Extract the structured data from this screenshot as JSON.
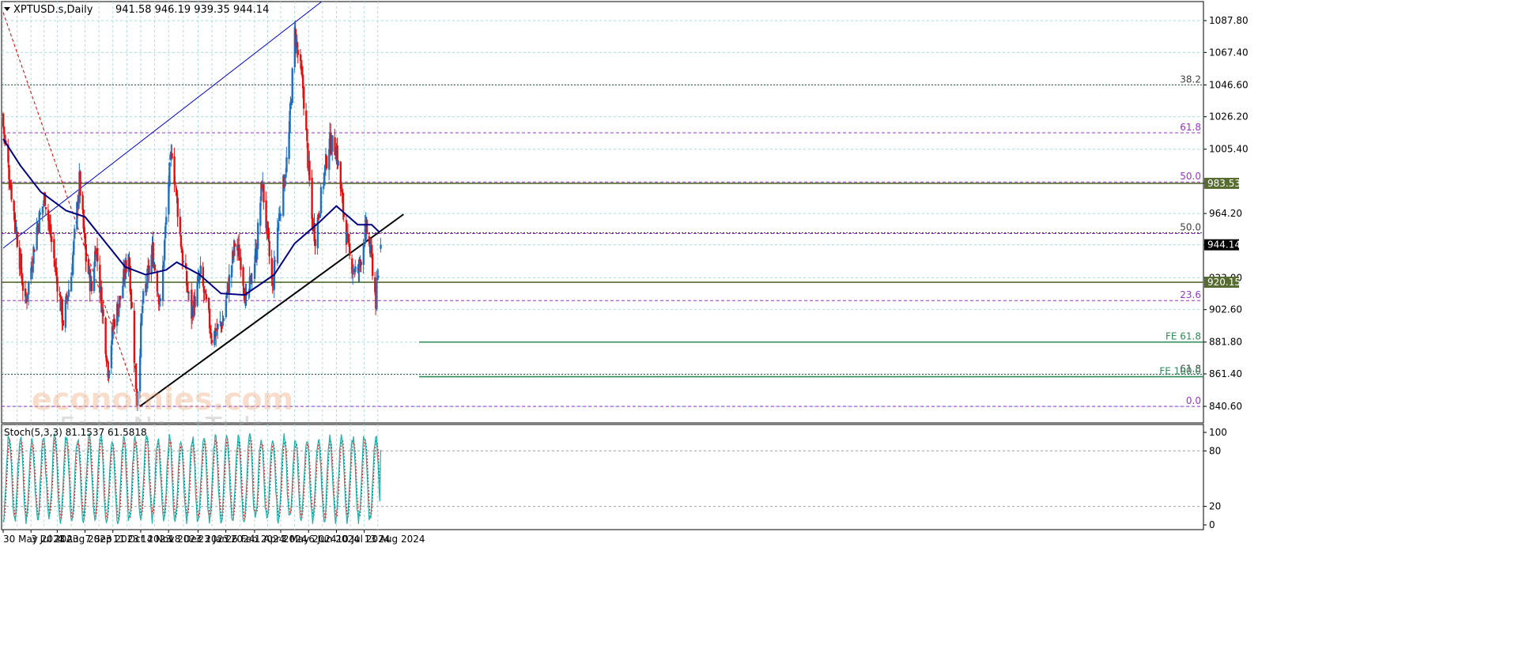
{
  "header": {
    "symbol": "XPTUSD.s,Daily",
    "ohlc": "941.58 946.19 939.35 944.14",
    "menu_icon": "triangle-down-icon"
  },
  "watermark": {
    "line1": "economies.com",
    "line2": "ForexNewsToday"
  },
  "chart_data": [
    {
      "type": "candlestick",
      "symbol": "XPTUSD.s",
      "timeframe": "Daily",
      "last": {
        "open": 941.58,
        "high": 946.19,
        "low": 939.35,
        "close": 944.14
      },
      "ylim": [
        830,
        1100
      ],
      "price_ticks": [
        840.6,
        861.4,
        881.8,
        902.6,
        923.0,
        944.14,
        964.2,
        983.53,
        1005.4,
        1026.2,
        1046.6,
        1067.4,
        1087.8
      ],
      "price_tick_labels": [
        "840.60",
        "861.40",
        "881.80",
        "902.60",
        "923.00",
        "944.14",
        "964.20",
        "983.53",
        "1005.40",
        "1026.20",
        "1046.60",
        "1067.40",
        "1087.80"
      ],
      "highlighted_prices": [
        {
          "label": "983.53",
          "value": 983.53,
          "bg": "#556b2f"
        },
        {
          "label": "944.14",
          "value": 944.14,
          "bg": "#000000"
        },
        {
          "label": "920.15",
          "value": 920.15,
          "bg": "#556b2f"
        }
      ],
      "x_tick_labels": [
        "30 May 2023",
        "3 Jul 2023",
        "4 Aug 2023",
        "7 Sep 2023",
        "11 Oct 2023",
        "14 Nov 2023",
        "18 Dec 2023",
        "23 Jan 2024",
        "26 Feb 2024",
        "1 Apr 2024",
        "3 May 2024",
        "6 Jun 2024",
        "10 Jul 2024",
        "13 Aug 2024"
      ],
      "keypoints": [
        {
          "date": "30 May 2023",
          "close": 1020
        },
        {
          "date": "2023-06-12",
          "close": 965
        },
        {
          "date": "2023-06-26",
          "close": 905
        },
        {
          "date": "2023-07-10",
          "close": 955
        },
        {
          "date": "2023-07-20",
          "close": 975
        },
        {
          "date": "2023-07-31",
          "close": 935
        },
        {
          "date": "2023-08-11",
          "close": 895
        },
        {
          "date": "2023-08-21",
          "close": 925
        },
        {
          "date": "2023-08-31",
          "close": 985
        },
        {
          "date": "2023-09-08",
          "close": 935
        },
        {
          "date": "2023-09-15",
          "close": 915
        },
        {
          "date": "2023-09-20",
          "close": 945
        },
        {
          "date": "2023-10-05",
          "close": 865
        },
        {
          "date": "2023-10-12",
          "close": 895
        },
        {
          "date": "2023-10-20",
          "close": 910
        },
        {
          "date": "2023-10-30",
          "close": 940
        },
        {
          "date": "2023-11-09",
          "close": 845
        },
        {
          "date": "2023-11-16",
          "close": 905
        },
        {
          "date": "2023-11-28",
          "close": 940
        },
        {
          "date": "2023-12-08",
          "close": 905
        },
        {
          "date": "2023-12-18",
          "close": 985
        },
        {
          "date": "2023-12-22",
          "close": 1005
        },
        {
          "date": "2024-01-04",
          "close": 935
        },
        {
          "date": "2024-01-15",
          "close": 900
        },
        {
          "date": "2024-01-26",
          "close": 925
        },
        {
          "date": "2024-02-09",
          "close": 885
        },
        {
          "date": "2024-02-22",
          "close": 895
        },
        {
          "date": "2024-03-08",
          "close": 945
        },
        {
          "date": "2024-03-15",
          "close": 935
        },
        {
          "date": "2024-03-22",
          "close": 905
        },
        {
          "date": "2024-04-03",
          "close": 940
        },
        {
          "date": "2024-04-10",
          "close": 985
        },
        {
          "date": "2024-04-23",
          "close": 915
        },
        {
          "date": "2024-04-29",
          "close": 955
        },
        {
          "date": "2024-05-12",
          "close": 1005
        },
        {
          "date": "2024-05-20",
          "close": 1080
        },
        {
          "date": "2024-05-30",
          "close": 1045
        },
        {
          "date": "2024-06-10",
          "close": 960
        },
        {
          "date": "2024-06-14",
          "close": 950
        },
        {
          "date": "2024-06-24",
          "close": 985
        },
        {
          "date": "2024-07-01",
          "close": 1010
        },
        {
          "date": "2024-07-10",
          "close": 1005
        },
        {
          "date": "2024-07-16",
          "close": 975
        },
        {
          "date": "2024-07-26",
          "close": 935
        },
        {
          "date": "2024-08-05",
          "close": 925
        },
        {
          "date": "2024-08-15",
          "close": 955
        },
        {
          "date": "2024-08-22",
          "close": 935
        },
        {
          "date": "2024-08-27",
          "close": 908
        },
        {
          "date": "2024-09-02",
          "close": 944.14
        }
      ],
      "moving_average": {
        "color": "#000080",
        "values": [
          {
            "date": "30 May 2023",
            "value": 1012
          },
          {
            "date": "2023-06-20",
            "value": 995
          },
          {
            "date": "2023-07-15",
            "value": 978
          },
          {
            "date": "2023-08-15",
            "value": 966
          },
          {
            "date": "2023-09-07",
            "value": 962
          },
          {
            "date": "2023-10-03",
            "value": 945
          },
          {
            "date": "2023-10-26",
            "value": 930
          },
          {
            "date": "2023-11-20",
            "value": 925
          },
          {
            "date": "2023-12-15",
            "value": 928
          },
          {
            "date": "2023-12-28",
            "value": 933
          },
          {
            "date": "2024-01-25",
            "value": 925
          },
          {
            "date": "2024-02-20",
            "value": 913
          },
          {
            "date": "2024-03-20",
            "value": 912
          },
          {
            "date": "2024-04-25",
            "value": 925
          },
          {
            "date": "2024-05-20",
            "value": 945
          },
          {
            "date": "2024-06-20",
            "value": 959
          },
          {
            "date": "2024-07-10",
            "value": 969
          },
          {
            "date": "2024-08-05",
            "value": 957
          },
          {
            "date": "2024-08-22",
            "value": 957
          },
          {
            "date": "2024-09-01",
            "value": 952
          }
        ]
      },
      "trendlines": [
        {
          "color": "#0000cc",
          "style": "solid",
          "from": {
            "date": "30 May 2023",
            "price": 942
          },
          "to": {
            "date": "2024-06-22",
            "price": 1100
          }
        },
        {
          "color": "#000000",
          "style": "solid",
          "from": {
            "date": "2023-11-13",
            "price": 840.6
          },
          "to": {
            "date": "2024-09-30",
            "price": 963.7
          }
        },
        {
          "color": "#dd0000",
          "style": "dashed",
          "from": {
            "date": "30 May 2023",
            "price": 1093
          },
          "to": {
            "date": "2023-11-13",
            "price": 840.6
          }
        }
      ],
      "horizontal_levels": [
        {
          "price": 1046.6,
          "label": "38.2",
          "color": "#404040",
          "style": "dotted"
        },
        {
          "price": 1015.9,
          "label": "61.8",
          "color": "#9933cc",
          "style": "dashed"
        },
        {
          "price": 984.4,
          "label": "50.0",
          "color": "#9933cc",
          "style": "dashed"
        },
        {
          "price": 983.53,
          "label": "",
          "color": "#556b2f",
          "style": "solid"
        },
        {
          "price": 951.8,
          "label": "50.0",
          "color": "#404040",
          "style": "dotted"
        },
        {
          "price": 951.3,
          "label": "",
          "color": "#9933cc",
          "style": "dashed"
        },
        {
          "price": 920.15,
          "label": "",
          "color": "#556b2f",
          "style": "solid"
        },
        {
          "price": 908.4,
          "label": "23.6",
          "color": "#9933cc",
          "style": "dashed"
        },
        {
          "price": 881.8,
          "label": "FE 61.8",
          "color": "#2e8b57",
          "style": "solid"
        },
        {
          "price": 861.1,
          "label": "61.8",
          "color": "#404040",
          "style": "dotted"
        },
        {
          "price": 859.6,
          "label": "FE 100.0",
          "color": "#2e8b57",
          "style": "solid"
        },
        {
          "price": 840.6,
          "label": "0.0",
          "color": "#9933cc",
          "style": "dashed"
        }
      ]
    },
    {
      "type": "line",
      "title": "Stoch(5,3,3) 81.1537 61.5818",
      "ylim": [
        0,
        100
      ],
      "y_tick_labels": [
        "100",
        "80",
        "20",
        "0"
      ],
      "y_ticks": [
        100,
        80,
        20,
        0
      ],
      "levels": [
        80,
        20
      ],
      "series": [
        {
          "color": "#20b2aa",
          "style": "solid"
        },
        {
          "color": "#dd0000",
          "style": "dotted"
        }
      ],
      "cycle_days": [
        0,
        14,
        28,
        42,
        56,
        70,
        84,
        98,
        112,
        126,
        140,
        154,
        168,
        182,
        196,
        210,
        224,
        238,
        252,
        266,
        280,
        294,
        308,
        322,
        336,
        350,
        364,
        378,
        392,
        406,
        420,
        434,
        448,
        462
      ],
      "last_main": 81.1537,
      "last_signal": 61.5818
    }
  ]
}
